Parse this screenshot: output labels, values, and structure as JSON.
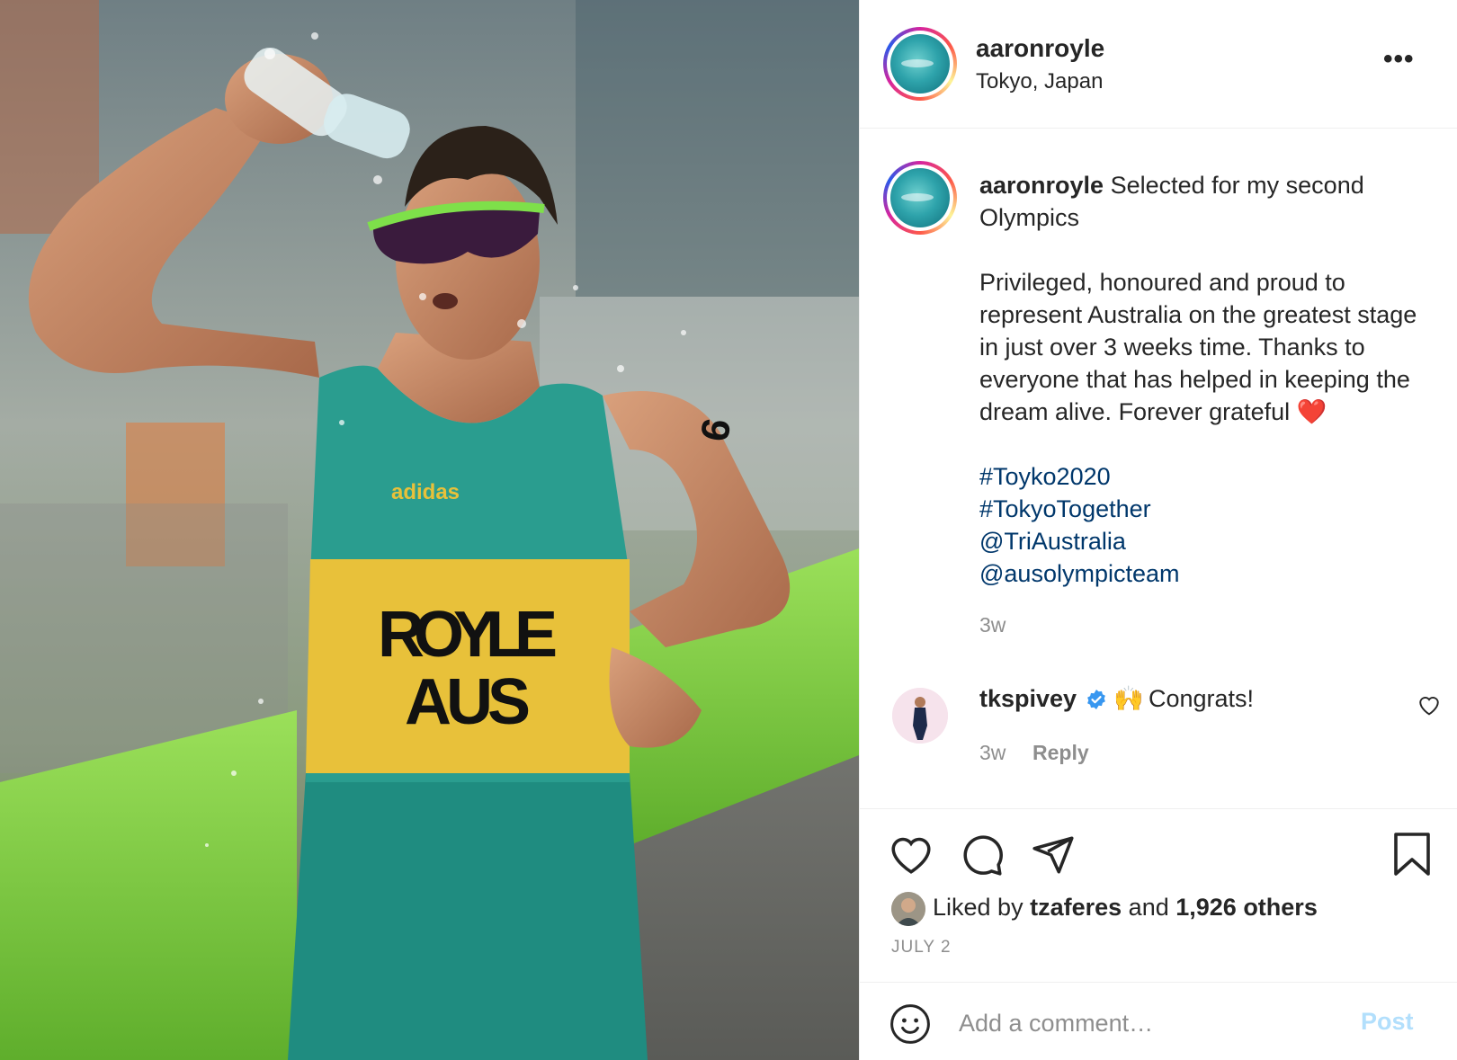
{
  "photo": {
    "jersey_name": "ROYLE",
    "jersey_country": "AUS",
    "jersey_brand": "adidas",
    "arm_number": "9"
  },
  "post_header": {
    "username": "aaronroyle",
    "location": "Tokyo, Japan",
    "more_label": "•••"
  },
  "caption": {
    "username": "aaronroyle",
    "headline": "Selected for my second Olympics",
    "body": "Privileged, honoured and proud to represent Australia on the greatest stage in just over 3 weeks time. Thanks to everyone that has helped in keeping the dream alive. Forever grateful",
    "emoji": "❤️",
    "tags": [
      "#Toyko2020",
      "#TokyoTogether",
      "@TriAustralia",
      "@ausolympicteam"
    ],
    "time": "3w"
  },
  "comment": {
    "username": "tkspivey",
    "emoji": "🙌",
    "text": "Congrats!",
    "time": "3w",
    "reply_label": "Reply"
  },
  "actions": {
    "liked_prefix": "Liked by",
    "liked_user": "tzaferes",
    "liked_and": "and",
    "liked_count": "1,926 others",
    "date": "JULY 2"
  },
  "add_comment": {
    "placeholder": "Add a comment…",
    "post_label": "Post"
  },
  "colors": {
    "link": "#00376b",
    "secondary_text": "#8e8e8e",
    "post_disabled": "#b2dffc",
    "verified": "#3897f0",
    "jersey_green": "#1f8c80",
    "jersey_yellow": "#e8c13a"
  }
}
